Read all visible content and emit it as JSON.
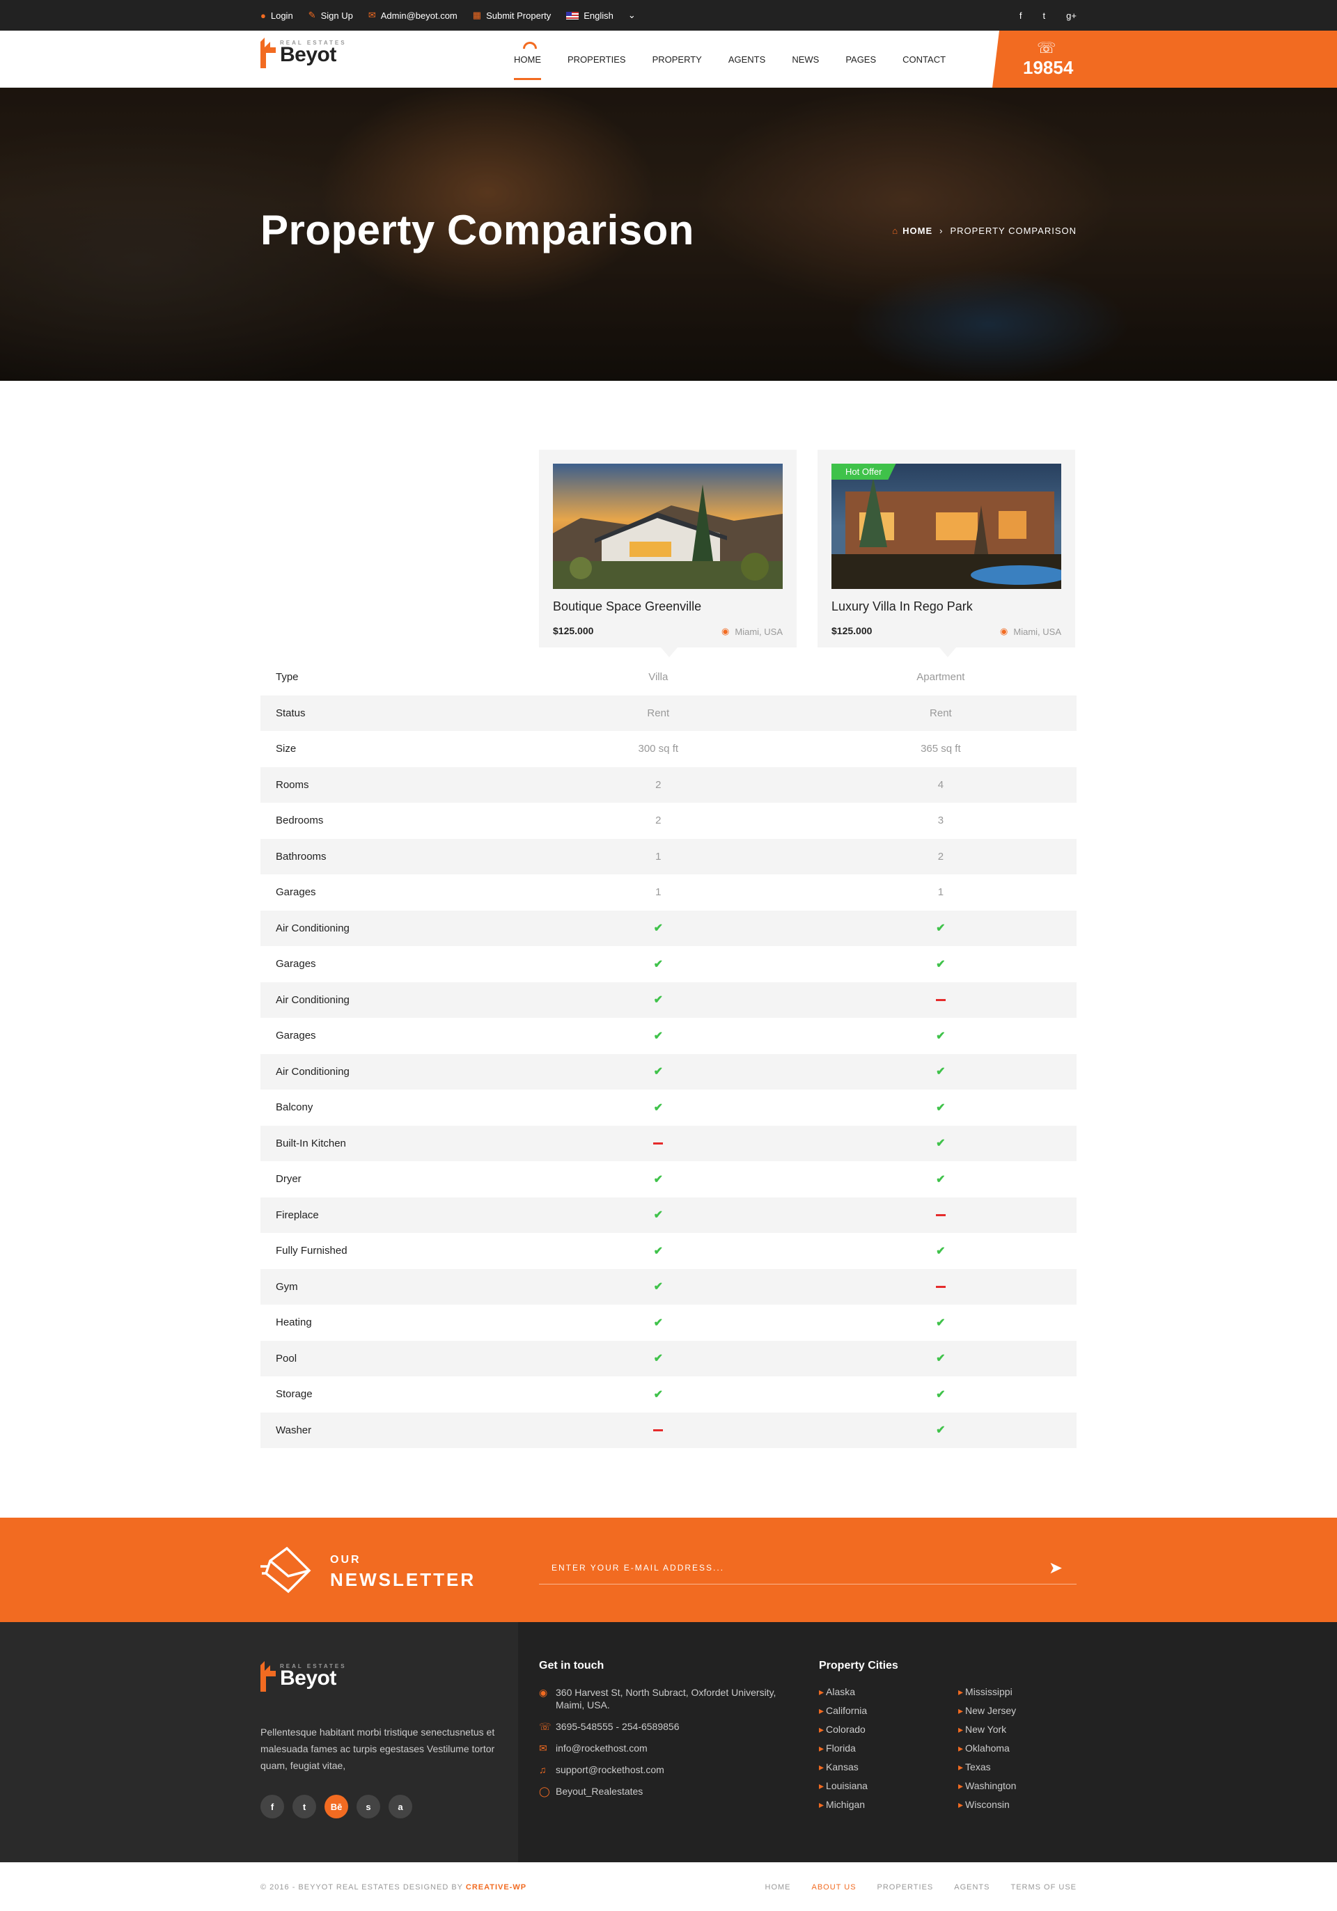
{
  "topbar": {
    "login": "Login",
    "signup": "Sign Up",
    "email": "Admin@beyot.com",
    "submit": "Submit Property",
    "language": "English",
    "social": [
      "f",
      "t",
      "g+"
    ]
  },
  "logo": {
    "small": "REAL ESTATES",
    "big": "Beyot"
  },
  "nav": [
    "HOME",
    "PROPERTIES",
    "PROPERTY",
    "AGENTS",
    "NEWS",
    "PAGES",
    "CONTACT"
  ],
  "phone": "19854",
  "hero": {
    "title": "Property Comparison",
    "crumb_home": "HOME",
    "crumb_current": "PROPERTY COMPARISON"
  },
  "properties": [
    {
      "title": "Boutique Space Greenville",
      "price": "$125.000",
      "location": "Miami, USA",
      "badge": ""
    },
    {
      "title": "Luxury Villa In Rego Park",
      "price": "$125.000",
      "location": "Miami, USA",
      "badge": "Hot Offer"
    }
  ],
  "comparison": [
    {
      "label": "Type",
      "a": "Villa",
      "b": "Apartment"
    },
    {
      "label": "Status",
      "a": "Rent",
      "b": "Rent"
    },
    {
      "label": "Size",
      "a": "300 sq ft",
      "b": "365 sq ft"
    },
    {
      "label": "Rooms",
      "a": "2",
      "b": "4"
    },
    {
      "label": "Bedrooms",
      "a": "2",
      "b": "3"
    },
    {
      "label": "Bathrooms",
      "a": "1",
      "b": "2"
    },
    {
      "label": "Garages",
      "a": "1",
      "b": "1"
    },
    {
      "label": "Air Conditioning",
      "a": true,
      "b": true
    },
    {
      "label": "Garages",
      "a": true,
      "b": true
    },
    {
      "label": "Air Conditioning",
      "a": true,
      "b": false
    },
    {
      "label": "Garages",
      "a": true,
      "b": true
    },
    {
      "label": "Air Conditioning",
      "a": true,
      "b": true
    },
    {
      "label": "Balcony",
      "a": true,
      "b": true
    },
    {
      "label": "Built-In Kitchen",
      "a": false,
      "b": true
    },
    {
      "label": "Dryer",
      "a": true,
      "b": true
    },
    {
      "label": "Fireplace",
      "a": true,
      "b": false
    },
    {
      "label": "Fully Furnished",
      "a": true,
      "b": true
    },
    {
      "label": "Gym",
      "a": true,
      "b": false
    },
    {
      "label": "Heating",
      "a": true,
      "b": true
    },
    {
      "label": "Pool",
      "a": true,
      "b": true
    },
    {
      "label": "Storage",
      "a": true,
      "b": true
    },
    {
      "label": "Washer",
      "a": false,
      "b": true
    }
  ],
  "newsletter": {
    "our": "OUR",
    "title": "NEWSLETTER",
    "placeholder": "ENTER YOUR E-MAIL ADDRESS..."
  },
  "footer": {
    "description": "Pellentesque habitant morbi tristique senectusnetus et malesuada fames ac turpis egestases Vestilume tortor quam, feugiat vitae,",
    "social": [
      "f",
      "t",
      "Bē",
      "s",
      "a"
    ],
    "contact_title": "Get in touch",
    "contact": [
      {
        "icon": "map-pin",
        "text": "360 Harvest St, North Subract, Oxfordet University, Maimi, USA."
      },
      {
        "icon": "phone",
        "text": "3695-548555 - 254-6589856"
      },
      {
        "icon": "mail",
        "text": "info@rockethost.com"
      },
      {
        "icon": "headset",
        "text": "support@rockethost.com"
      },
      {
        "icon": "skype",
        "text": "Beyout_Realestates"
      }
    ],
    "cities_title": "Property Cities",
    "cities_a": [
      "Alaska",
      "California",
      "Colorado",
      "Florida",
      "Kansas",
      "Louisiana",
      "Michigan"
    ],
    "cities_b": [
      "Mississippi",
      "New Jersey",
      "New York",
      "Oklahoma",
      "Texas",
      "Washington",
      "Wisconsin"
    ]
  },
  "bottom": {
    "copy": "© 2016 - BEYYOT REAL ESTATES DESIGNED BY",
    "designer": "CREATIVE-WP",
    "links": [
      "HOME",
      "ABOUT US",
      "PROPERTIES",
      "AGENTS",
      "TERMS OF USE"
    ],
    "active_link": "ABOUT US"
  },
  "colors": {
    "accent": "#f26b21",
    "dark": "#222222",
    "yes": "#3fc24a",
    "no": "#e52b2b"
  }
}
